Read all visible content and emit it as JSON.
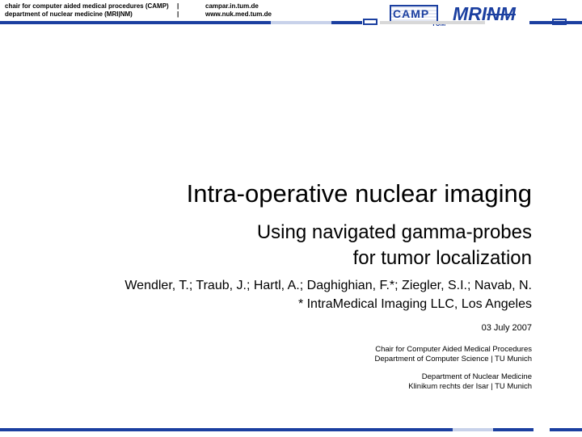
{
  "header": {
    "line1_left": "chair for computer aided medical procedures (CAMP)",
    "line2_left": "department of nuclear medicine (MRI|NM)",
    "separator": "|",
    "line1_right": "campar.in.tum.de",
    "line2_right": "www.nuk.med.tum.de",
    "logo_camp": "CAMP",
    "logo_tum": "TUM",
    "logo_mri": "MRI",
    "logo_nm": "NM"
  },
  "title": "Intra-operative nuclear imaging",
  "subtitle_line1": "Using navigated gamma-probes",
  "subtitle_line2": "for tumor localization",
  "authors": "Wendler, T.; Traub, J.; Hartl, A.; Daghighian, F.*; Ziegler, S.I.; Navab, N.",
  "affiliation_note": "* IntraMedical Imaging LLC, Los Angeles",
  "date": "03 July 2007",
  "institution1_line1": "Chair for Computer Aided Medical Procedures",
  "institution1_line2": "Department of Computer Science | TU Munich",
  "institution2_line1": "Department of Nuclear Medicine",
  "institution2_line2": "Klinikum rechts der Isar | TU Munich",
  "colors": {
    "brand_blue": "#1b3fa0",
    "bar_light": "#c8d2ea",
    "bar_gray": "#d8d8d8"
  }
}
